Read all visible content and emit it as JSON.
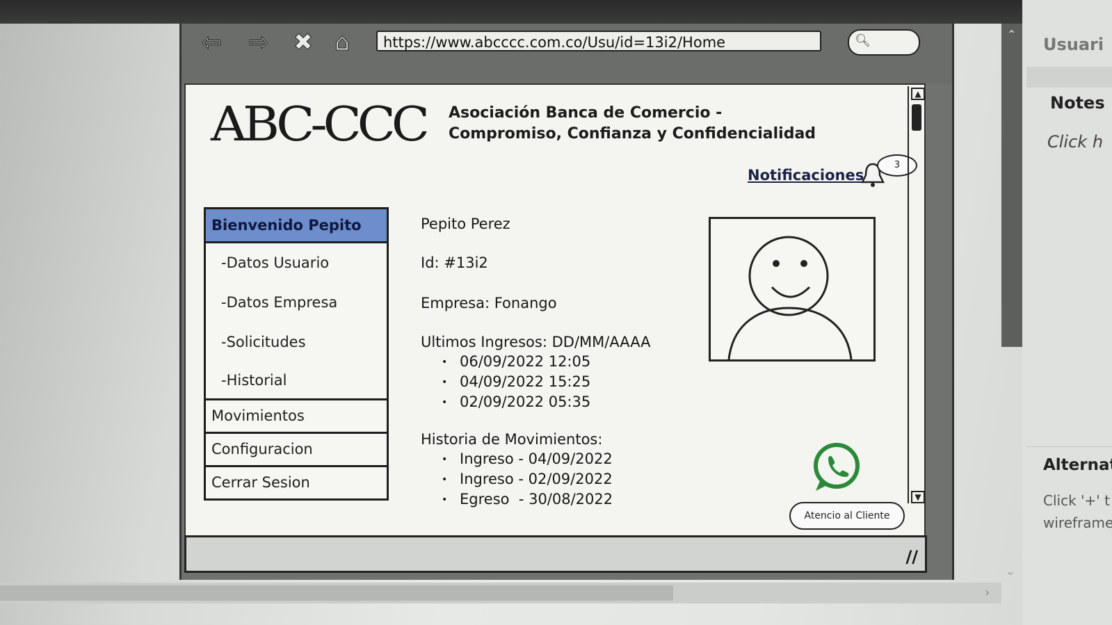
{
  "browser": {
    "url": "https://www.abcccc.com.co/Usu/id=13i2/Home",
    "nav_icons": [
      "arrow-left-icon",
      "arrow-right-icon",
      "close-icon",
      "home-icon"
    ],
    "search_icon": "search-icon"
  },
  "header": {
    "logo_text": "ABC-CCC",
    "org_line1": "Asociación Banca de Comercio -",
    "org_line2": "Compromiso, Confianza y Confidencialidad",
    "notifications_label": "Notificaciones",
    "notifications_count": "3"
  },
  "menu": {
    "welcome": "Bienvenido Pepito",
    "sub_items": [
      "-Datos Usuario",
      "-Datos Empresa",
      "-Solicitudes",
      "-Historial"
    ],
    "items": [
      "Movimientos",
      "Configuracion",
      "Cerrar Sesion"
    ]
  },
  "user": {
    "name": "Pepito Perez",
    "id": "Id: #13i2",
    "company": "Empresa: Fonango",
    "last_logins_label": "Ultimos Ingresos: DD/MM/AAAA",
    "last_logins": [
      "06/09/2022 12:05",
      "04/09/2022  15:25",
      "02/09/2022 05:35"
    ],
    "history_label": "Historia de Movimientos:",
    "history": [
      "Ingreso - 04/09/2022",
      "Ingreso - 02/09/2022",
      "Egreso  - 30/08/2022"
    ]
  },
  "support": {
    "label": "Atencio al Cliente",
    "icon": "whatsapp-icon"
  },
  "editor_panel": {
    "user_tab": "Usuari",
    "notes_title": "Notes",
    "notes_placeholder": "Click h",
    "alt_title": "Alternat",
    "alt_text_line1": "Click '+' t",
    "alt_text_line2": "wireframe"
  },
  "colors": {
    "menu_header": "#6d8dcc",
    "whatsapp_green": "#2a8a3a",
    "page_bg": "#f4f5f1"
  }
}
